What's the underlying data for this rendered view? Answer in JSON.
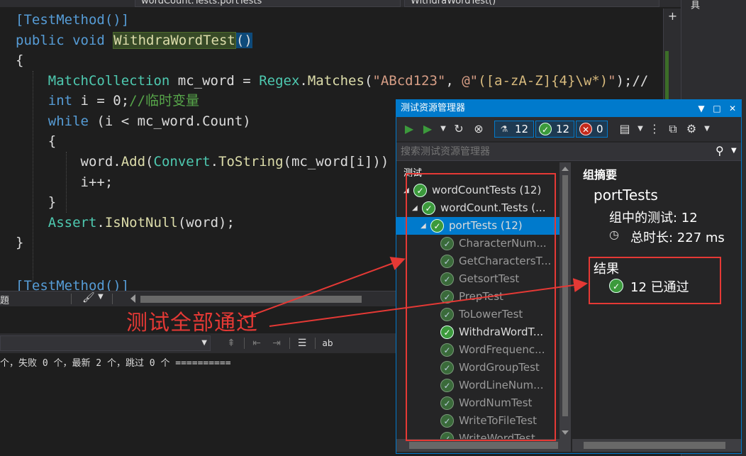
{
  "editor": {
    "nav": {
      "item1": "wordCount.Tests.portTests",
      "item2": "WithdraWordTest()"
    },
    "lines": [
      {
        "parts": [
          [
            "k",
            "[TestMethod()]"
          ]
        ]
      },
      {
        "parts": [
          [
            "k",
            "public "
          ],
          [
            "k",
            "void "
          ],
          [
            "hl",
            "WithdraWordTest"
          ],
          [
            "br",
            "("
          ],
          [
            "br",
            ")"
          ]
        ]
      },
      {
        "parts": [
          [
            "",
            "{"
          ]
        ]
      },
      {
        "parts": [
          [
            "",
            "    "
          ],
          [
            "t",
            "MatchCollection"
          ],
          [
            "",
            " mc_word = "
          ],
          [
            "t",
            "Regex"
          ],
          [
            "",
            "."
          ],
          [
            "m",
            "Matches"
          ],
          [
            "",
            "("
          ],
          [
            "s",
            "\"ABcd123\""
          ],
          [
            "",
            ", "
          ],
          [
            "s",
            "@\""
          ],
          [
            "re",
            "([a-zA-Z]{4}\\w*)"
          ],
          [
            "s",
            "\""
          ],
          [
            "",
            ");//"
          ]
        ]
      },
      {
        "parts": [
          [
            "",
            "    "
          ],
          [
            "k",
            "int"
          ],
          [
            "",
            " i = 0;"
          ],
          [
            "c",
            "//临时变量"
          ]
        ]
      },
      {
        "parts": [
          [
            "",
            "    "
          ],
          [
            "k",
            "while"
          ],
          [
            "",
            " (i < mc_word.Count)"
          ]
        ]
      },
      {
        "parts": [
          [
            "",
            "    {"
          ]
        ]
      },
      {
        "parts": [
          [
            "",
            "        word."
          ],
          [
            "m",
            "Add"
          ],
          [
            "",
            "("
          ],
          [
            "t",
            "Convert"
          ],
          [
            "",
            "."
          ],
          [
            "m",
            "ToString"
          ],
          [
            "",
            "(mc_word[i]))"
          ]
        ]
      },
      {
        "parts": [
          [
            "",
            "        i++;"
          ]
        ]
      },
      {
        "parts": [
          [
            "",
            "    }"
          ]
        ]
      },
      {
        "parts": [
          [
            "",
            "    "
          ],
          [
            "t",
            "Assert"
          ],
          [
            "",
            "."
          ],
          [
            "m",
            "IsNotNull"
          ],
          [
            "",
            "(word);"
          ]
        ]
      },
      {
        "parts": [
          [
            "",
            "}"
          ]
        ]
      },
      {
        "parts": [
          [
            "",
            ""
          ]
        ]
      },
      {
        "parts": [
          [
            "k",
            "[TestMethod()]"
          ]
        ]
      }
    ],
    "add_icon": "+"
  },
  "right_strip": {
    "vertical_text": "具"
  },
  "lower_panel": {
    "tab_label": "題",
    "output_text": "个，失败 0 个，最新 2 个，跳过 0 个 =========="
  },
  "test_explorer": {
    "title": "测试资源管理器",
    "title_controls": {
      "dropdown": "▼",
      "maximize": "□",
      "close": "✕"
    },
    "toolbar": {
      "all_count": "12",
      "passed_count": "12",
      "failed_count": "0"
    },
    "search": {
      "placeholder": "搜索测试资源管理器"
    },
    "tree_header": "测试",
    "tree": [
      {
        "label": "wordCountTests (12)",
        "level": 0,
        "expand": "◢",
        "style": "normal"
      },
      {
        "label": "wordCount.Tests (...",
        "level": 1,
        "expand": "◢",
        "style": "normal"
      },
      {
        "label": "portTests (12)",
        "level": 2,
        "expand": "◢",
        "style": "selected"
      },
      {
        "label": "CharacterNum...",
        "level": 3,
        "style": "dim"
      },
      {
        "label": "GetCharactersT...",
        "level": 3,
        "style": "dim"
      },
      {
        "label": "GetsortTest",
        "level": 3,
        "style": "dim"
      },
      {
        "label": "PrepTest",
        "level": 3,
        "style": "dim"
      },
      {
        "label": "ToLowerTest",
        "level": 3,
        "style": "dim"
      },
      {
        "label": "WithdraWordT...",
        "level": 3,
        "style": "normal"
      },
      {
        "label": "WordFrequenc...",
        "level": 3,
        "style": "dim"
      },
      {
        "label": "WordGroupTest",
        "level": 3,
        "style": "dim"
      },
      {
        "label": "WordLineNum...",
        "level": 3,
        "style": "dim"
      },
      {
        "label": "WordNumTest",
        "level": 3,
        "style": "dim"
      },
      {
        "label": "WriteToFileTest",
        "level": 3,
        "style": "dim"
      },
      {
        "label": "WriteWordTest",
        "level": 3,
        "style": "dim"
      }
    ],
    "summary": {
      "group_header": "组摘要",
      "group_name": "portTests",
      "tests_label": "组中的测试: 12",
      "duration_label": "总时长: 227 ms",
      "results_header": "结果",
      "results_text": "12 已通过"
    }
  },
  "annotation": {
    "text": "测试全部通过",
    "color": "#e53935"
  },
  "colors": {
    "accent": "#007acc",
    "pass": "#3c9a3c",
    "fail": "#c42b1c",
    "annotation": "#e53935"
  }
}
